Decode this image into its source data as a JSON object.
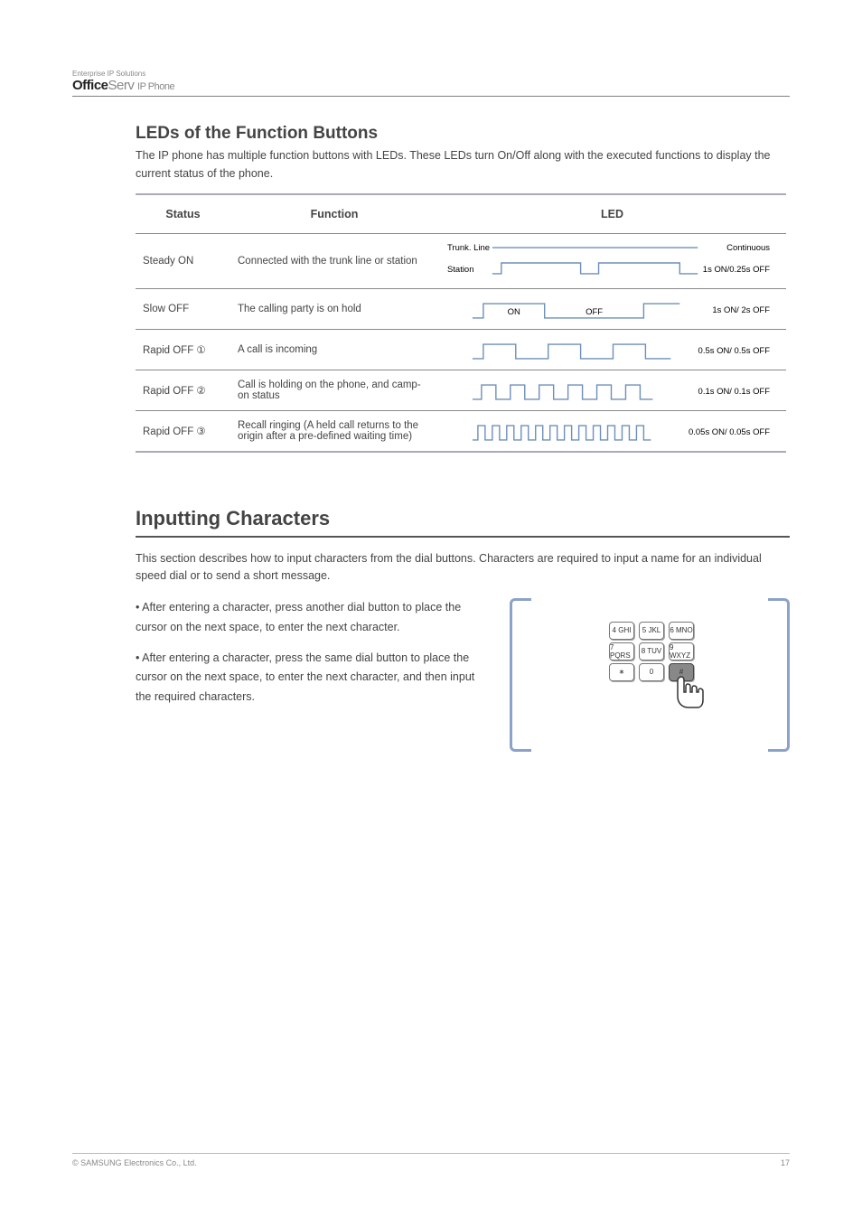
{
  "header": {
    "sub": "Enterprise IP Solutions",
    "brand_bold": "Office",
    "brand_light": "Serv",
    "brand_ip": "IP Phone"
  },
  "section1": {
    "title": "LEDs of the Function Buttons",
    "intro": "The IP phone has multiple function buttons with LEDs. These LEDs turn On/Off along with the executed functions to display the current status of the phone.",
    "table": {
      "headers": [
        "Status",
        "Function",
        "LED"
      ],
      "rows": [
        {
          "status": "Steady ON",
          "func": "Connected with the trunk line or station",
          "led": [
            "Trunk. Line",
            "Continuous",
            "Station",
            "1s ON/0.25s OFF"
          ]
        },
        {
          "status": "Slow OFF",
          "func": "The calling party is on hold",
          "led": [
            "ON",
            "OFF",
            "1s ON/ 2s OFF"
          ]
        },
        {
          "status": "Rapid OFF ①",
          "func": "A call is incoming",
          "led": "0.5s ON/ 0.5s OFF"
        },
        {
          "status": "Rapid OFF ②",
          "func": "Call is holding on the phone, and camp-on status",
          "led": "0.1s ON/ 0.1s OFF"
        },
        {
          "status": "Rapid OFF ③",
          "func": "Recall ringing (A held call returns to the origin after a pre-defined waiting time)",
          "led": "0.05s ON/ 0.05s OFF"
        }
      ]
    }
  },
  "section2": {
    "title": "Inputting Characters",
    "p1": "This section describes how to input characters from the dial buttons. Characters are required to input a name for an individual speed dial or to send a short message.",
    "pA": "• After entering a character, press another dial button to place the cursor on the next space, to enter the next character.",
    "pB": "• After entering a character, press the same dial button to place the cursor on the next space, to enter the next character, and then input the required characters.",
    "keys": [
      "4 GHI",
      "5 JKL",
      "6 MNO",
      "7 PQRS",
      "8 TUV",
      "9 WXYZ",
      "∗",
      "0",
      "#"
    ]
  },
  "footer": {
    "left": "© SAMSUNG Electronics Co., Ltd.",
    "right": "17"
  }
}
